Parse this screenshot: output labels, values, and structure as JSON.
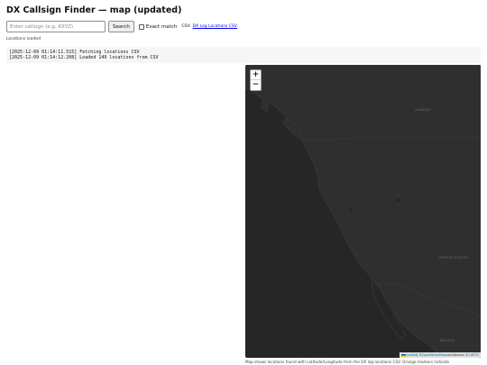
{
  "page": {
    "title": "DX Callsign Finder — map (updated)"
  },
  "search": {
    "placeholder": "Enter callsign (e.g. KXYZ)",
    "value": "",
    "button_label": "Search",
    "exact_match_label": "Exact match",
    "exact_match_checked": false,
    "csv_prefix": "CSV:",
    "csv_link_label": "DX Log Locations CSV"
  },
  "status": {
    "text": "Locations loaded"
  },
  "log": {
    "lines": [
      "[2025-12-09 01:14:11.515] Fetching locations CSV",
      "[2025-12-09 01:14:12.208] Loaded 149 locations from CSV"
    ]
  },
  "map": {
    "zoom_in_label": "+",
    "zoom_out_label": "−",
    "labels": {
      "canada": "CANADA",
      "united_states": "UNITED STATES",
      "mexico": "MEXICO"
    },
    "attribution": {
      "flag_icon": "ukraine-flag-icon",
      "leaflet": "Leaflet",
      "sep1": " | © ",
      "osm": "OpenStreetMap",
      "mid": " contributors © ",
      "carto": "CARTO"
    },
    "colors": {
      "ocean": "#262626",
      "land": "#2f2f2f",
      "coast": "#3d3d3d",
      "border": "#3a3a3a"
    },
    "caption": "Map shows locations found with Latitude/Longitude from the DX log locations CSV. Orange markers indicate"
  }
}
